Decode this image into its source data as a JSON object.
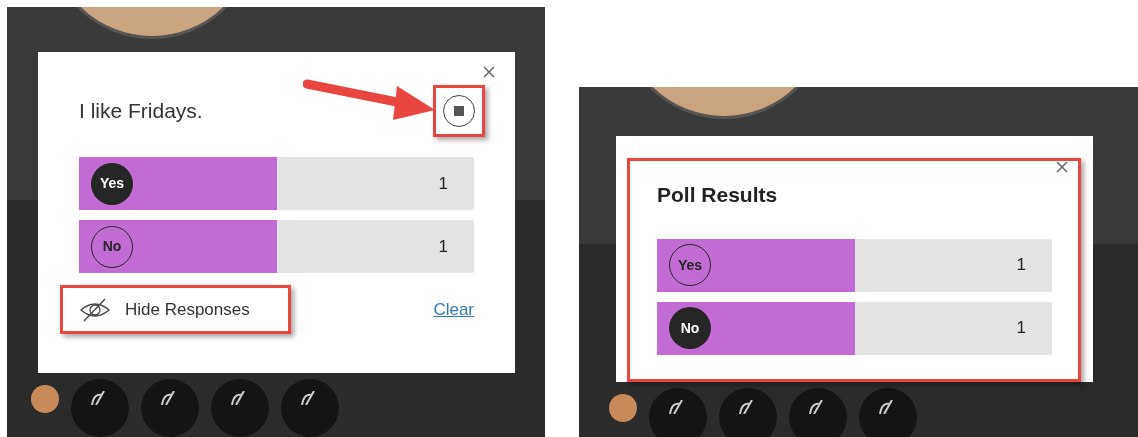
{
  "left": {
    "question": "I like Fridays.",
    "options": [
      {
        "label": "Yes",
        "selected": true,
        "level": 0.5,
        "count": "1"
      },
      {
        "label": "No",
        "selected": false,
        "level": 0.5,
        "count": "1"
      }
    ],
    "hide_button": "Hide Responses",
    "clear_link": "Clear"
  },
  "right": {
    "title": "Poll Results",
    "options": [
      {
        "label": "Yes",
        "selected": false,
        "level": 0.5,
        "count": "1"
      },
      {
        "label": "No",
        "selected": true,
        "level": 0.5,
        "count": "1"
      }
    ]
  }
}
